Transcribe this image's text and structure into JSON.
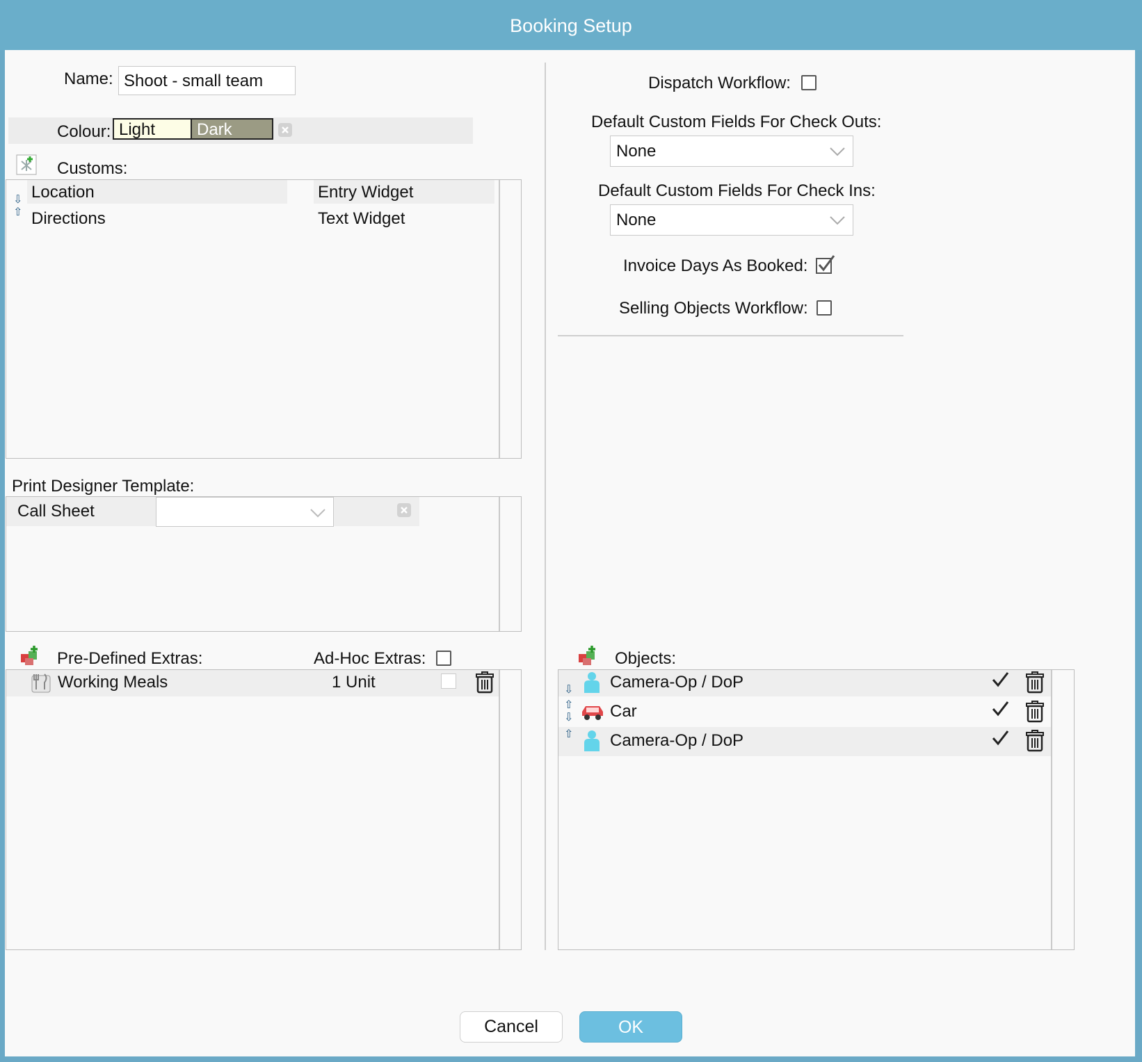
{
  "window": {
    "title": "Booking Setup"
  },
  "left": {
    "name_label": "Name:",
    "name_value": "Shoot - small team",
    "colour_label": "Colour:",
    "colour_light": "Light",
    "colour_dark": "Dark",
    "customs_label": "Customs:",
    "customs_rows": [
      {
        "name": "Location",
        "widget": "Entry Widget"
      },
      {
        "name": "Directions",
        "widget": "Text Widget"
      }
    ],
    "print_label": "Print Designer Template:",
    "print_rows": [
      {
        "name": "Call Sheet",
        "selected": ""
      }
    ],
    "predefined_label": "Pre-Defined Extras:",
    "adhoc_label": "Ad-Hoc Extras:",
    "extras_rows": [
      {
        "name": "Working Meals",
        "qty": "1 Unit",
        "icon": "meal-icon"
      }
    ]
  },
  "right": {
    "dispatch_label": "Dispatch Workflow:",
    "dispatch_checked": false,
    "checkouts_label": "Default Custom Fields For Check Outs:",
    "checkouts_value": "None",
    "checkins_label": "Default Custom Fields For Check Ins:",
    "checkins_value": "None",
    "invoice_label": "Invoice Days As Booked:",
    "invoice_checked": true,
    "selling_label": "Selling Objects Workflow:",
    "selling_checked": false,
    "objects_label": "Objects:",
    "objects_rows": [
      {
        "name": "Camera-Op / DoP",
        "icon": "person-icon",
        "checked": true
      },
      {
        "name": "Car",
        "icon": "car-icon",
        "checked": true
      },
      {
        "name": "Camera-Op / DoP",
        "icon": "person-icon",
        "checked": true
      }
    ]
  },
  "footer": {
    "cancel": "Cancel",
    "ok": "OK"
  },
  "colors": {
    "titlebar": "#6aaeca",
    "ok_button": "#6cbfe0",
    "colour_light": "#fdfde6",
    "colour_dark": "#9b9b84"
  }
}
